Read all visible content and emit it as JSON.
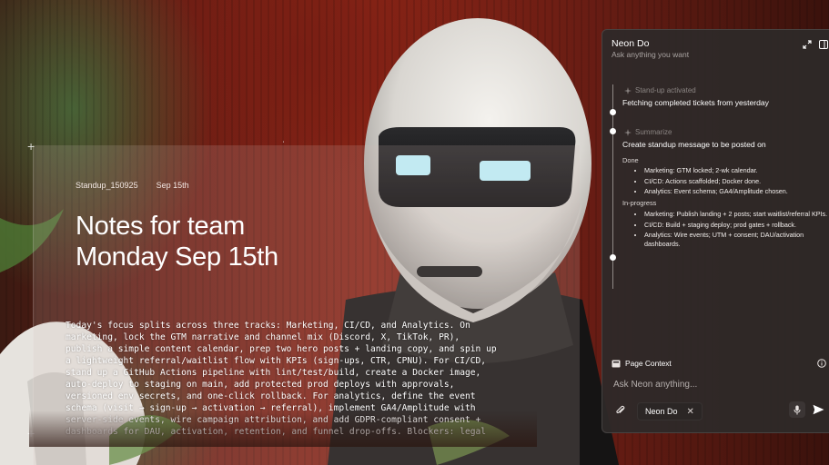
{
  "document": {
    "filename": "Standup_150925",
    "date": "Sep 15th",
    "title_line1": "Notes for team",
    "title_line2": "Monday Sep 15th",
    "body": "Today's focus splits across three tracks: Marketing, CI/CD, and Analytics. On marketing, lock the GTM narrative and channel mix (Discord, X, TikTok, PR), publish a simple content calendar, prep two hero posts + landing copy, and spin up a lightweight referral/waitlist flow with KPIs (sign-ups, CTR, CPNU). For CI/CD, stand up a GitHub Actions pipeline with lint/test/build, create a Docker image, auto-deploy to staging on main, add protected prod deploys with approvals, versioned env secrets, and one-click rollback. For analytics, define the event schema (visit → sign-up → activation → referral), implement GA4/Amplitude with server-side events, wire campaign attribution, and add GDPR-compliant consent + dashboards for DAU, activation, retention, and funnel drop-offs. Blockers: legal"
  },
  "assistant": {
    "title": "Neon Do",
    "subtitle": "Ask anything you want",
    "steps": [
      {
        "label": "Stand-up activated",
        "text": "Fetching completed tickets from yesterday"
      },
      {
        "label": "Summarize",
        "text": "Create standup message to be posted on"
      }
    ],
    "done_heading": "Done",
    "done_items": [
      "Marketing: GTM locked; 2-wk calendar.",
      "CI/CD: Actions scaffolded; Docker done.",
      "Analytics: Event schema; GA4/Amplitude chosen."
    ],
    "progress_heading": "In-progress",
    "progress_items": [
      "Marketing: Publish landing + 2 posts; start waitlist/referral KPIs.",
      "CI/CD: Build + staging deploy; prod gates + rollback.",
      "Analytics: Wire events; UTM + consent; DAU/activation dashboards."
    ],
    "context_label": "Page Context",
    "input_placeholder": "Ask Neon anything...",
    "chip_label": "Neon Do",
    "chip_close": "✕"
  },
  "colors": {
    "panel_bg": "#2e2928",
    "accent_text": "#ffffff",
    "muted_text": "#8a8482"
  },
  "icons": [
    "expand-icon",
    "sidebar-toggle-icon",
    "sparkle-icon",
    "page-context-icon",
    "info-icon",
    "attach-icon",
    "mic-icon",
    "send-icon"
  ]
}
